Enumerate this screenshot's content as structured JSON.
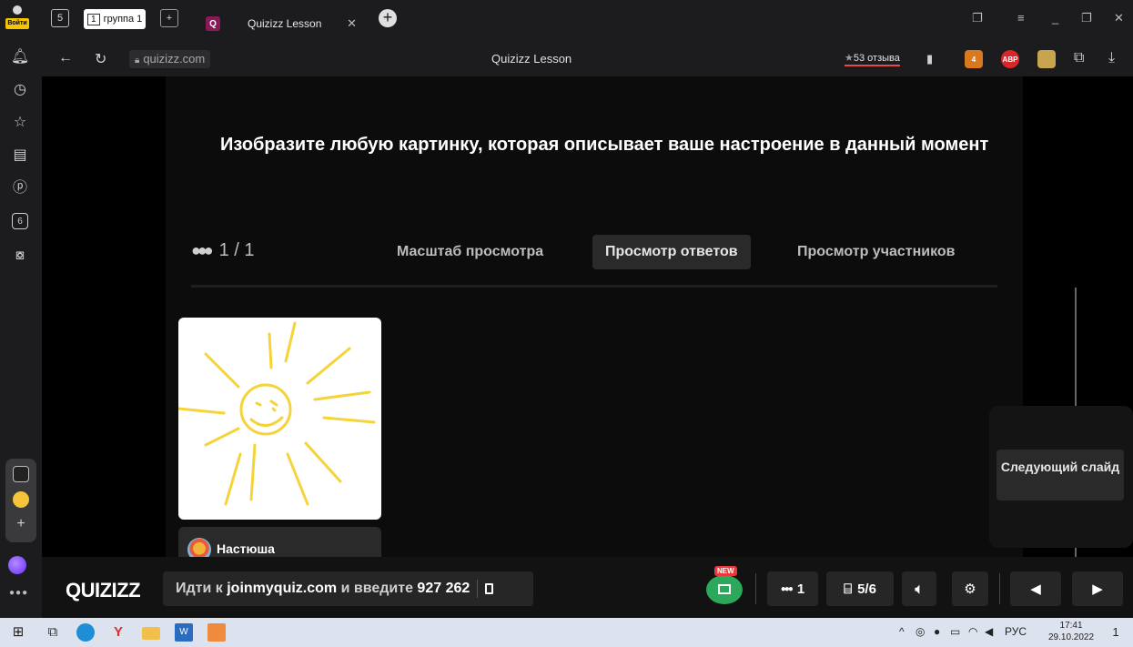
{
  "browser": {
    "login_label": "Войти",
    "home_badge": "5",
    "group_num": "1",
    "group_label": "группа 1",
    "tab_title": "Quizizz Lesson",
    "url": "quizizz.com",
    "page_title": "Quizizz Lesson",
    "reviews": "53 отзыва",
    "sidebar_badge": "6"
  },
  "lesson": {
    "question": "Изобразите любую картинку, которая описывает ваше настроение в данный момент",
    "responses_count": "1 / 1",
    "tabs": [
      {
        "label": "Масштаб просмотра",
        "active": false
      },
      {
        "label": "Просмотр ответов",
        "active": true
      },
      {
        "label": "Просмотр участников",
        "active": false
      }
    ],
    "response": {
      "name": "Настюша",
      "drawing": "sun-drawing",
      "stroke_color": "#f5d33b"
    },
    "next_slide_label": "Следующий слайд"
  },
  "quizizz_bar": {
    "logo": "QUIZIZZ",
    "join_prefix": "Идти к",
    "join_url": "joinmyquiz.com",
    "join_middle": "и введите",
    "join_code": "927 262",
    "new_tag": "NEW",
    "participants": "1",
    "slides": "5/6"
  },
  "taskbar": {
    "lang": "РУС",
    "time": "17:41",
    "date": "29.10.2022",
    "notif_count": "1"
  }
}
